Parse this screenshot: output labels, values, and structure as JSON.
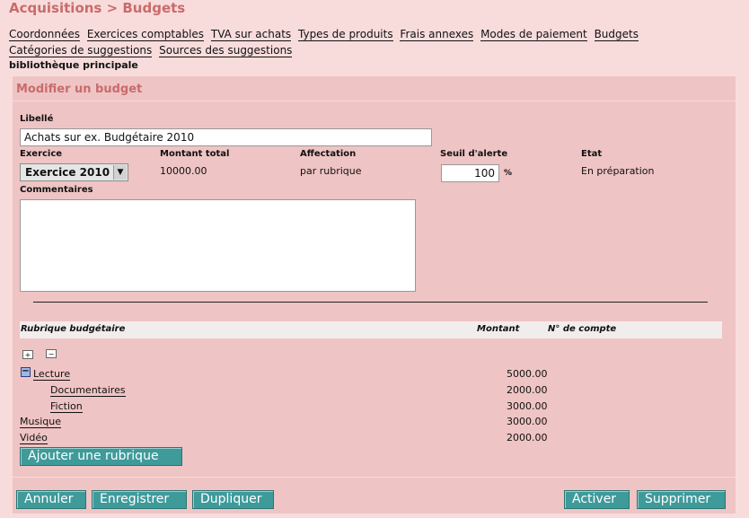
{
  "page_title": "Acquisitions > Budgets",
  "nav": [
    "Coordonnées",
    "Exercices comptables",
    "TVA sur achats",
    "Types de produits",
    "Frais annexes",
    "Modes de paiement",
    "Budgets",
    "Catégories de suggestions",
    "Sources des suggestions"
  ],
  "library": "bibliothèque principale",
  "form": {
    "title": "Modifier un budget",
    "libelle_label": "Libellé",
    "libelle_value": "Achats sur ex. Budgétaire 2010",
    "exercice_label": "Exercice",
    "exercice_value": "Exercice 2010",
    "montant_label": "Montant total",
    "montant_value": "10000.00",
    "affectation_label": "Affectation",
    "affectation_value": "par rubrique",
    "seuil_label": "Seuil d'alerte",
    "seuil_value": "100",
    "seuil_unit": "%",
    "etat_label": "Etat",
    "etat_value": "En préparation",
    "commentaires_label": "Commentaires",
    "commentaires_value": ""
  },
  "table": {
    "col_rubrique": "Rubrique budgétaire",
    "col_montant": "Montant",
    "col_compte": "N° de compte",
    "rows": [
      {
        "name": "Lecture",
        "amount": "5000.00"
      },
      {
        "name": "Documentaires",
        "amount": "2000.00"
      },
      {
        "name": "Fiction",
        "amount": "3000.00"
      },
      {
        "name": "Musique",
        "amount": "3000.00"
      },
      {
        "name": "Vidéo",
        "amount": "2000.00"
      }
    ]
  },
  "buttons": {
    "add": "Ajouter une rubrique",
    "cancel": "Annuler",
    "save": "Enregistrer",
    "duplicate": "Dupliquer",
    "activate": "Activer",
    "delete": "Supprimer"
  },
  "icons": {
    "expand_all": "expand-all-icon",
    "collapse_all": "collapse-all-icon",
    "collapse_node": "collapse-node-icon"
  },
  "colors": {
    "background": "#f8dcdc",
    "panel": "#efc4c4",
    "title": "#c96b6b",
    "button": "#3f9a9a"
  }
}
